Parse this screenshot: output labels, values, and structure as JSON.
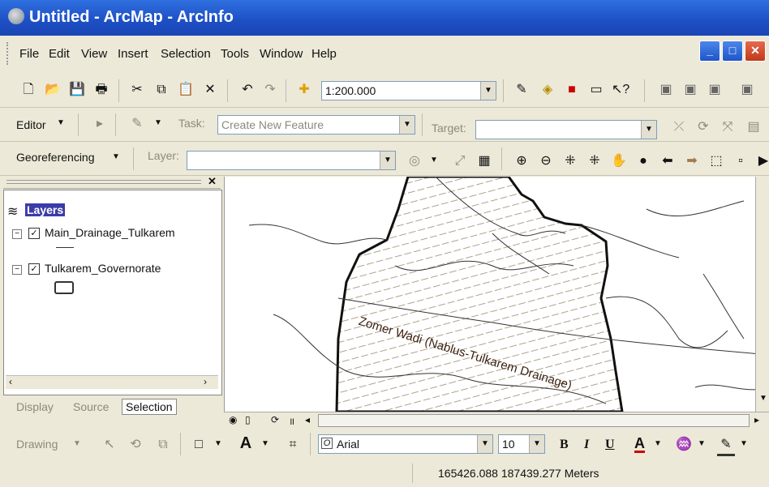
{
  "window": {
    "title": "Untitled - ArcMap - ArcInfo"
  },
  "menu": [
    "File",
    "Edit",
    "View",
    "Insert",
    "Selection",
    "Tools",
    "Window",
    "Help"
  ],
  "standard_toolbar": {
    "scale": "1:200.000"
  },
  "editor_toolbar": {
    "editor_label": "Editor",
    "task_label": "Task:",
    "task_value": "Create New Feature",
    "target_label": "Target:"
  },
  "georef_toolbar": {
    "label": "Georeferencing",
    "layer_label": "Layer:"
  },
  "toc": {
    "root_label": "Layers",
    "layers": [
      {
        "name": "Main_Drainage_Tulkarem",
        "checked": true
      },
      {
        "name": "Tulkarem_Governorate",
        "checked": true
      }
    ],
    "tabs": [
      "Display",
      "Source",
      "Selection"
    ]
  },
  "map": {
    "label": "Zomer Wadi (Nablus-Tulkarem Drainage)"
  },
  "drawing_toolbar": {
    "drawing_label": "Drawing",
    "font": "Arial",
    "font_size": "10",
    "bold": "B",
    "italic": "I",
    "underline": "U",
    "font_color_label": "A"
  },
  "status": {
    "coordinates": "165426.088  187439.277 Meters"
  },
  "colors": {
    "title_bar": "#1d4fc4",
    "selection_highlight": "#3c3ca8"
  }
}
